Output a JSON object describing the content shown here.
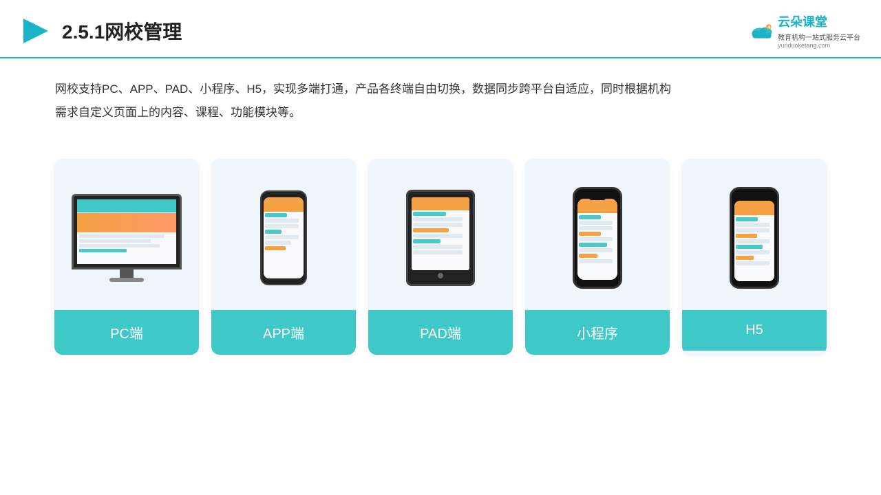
{
  "header": {
    "title": "2.5.1网校管理",
    "logo_main": "云朵课堂",
    "logo_url": "yunduoketang.com",
    "logo_slogan": "教育机构一站\n式服务云平台"
  },
  "description": {
    "line1": "网校支持PC、APP、PAD、小程序、H5，实现多端打通，产品各终端自由切换，数据同步跨平台自适应，同时根据机构",
    "line2": "需求自定义页面上的内容、课程、功能模块等。"
  },
  "cards": [
    {
      "id": "pc",
      "label": "PC端"
    },
    {
      "id": "app",
      "label": "APP端"
    },
    {
      "id": "pad",
      "label": "PAD端"
    },
    {
      "id": "miniapp",
      "label": "小程序"
    },
    {
      "id": "h5",
      "label": "H5"
    }
  ]
}
